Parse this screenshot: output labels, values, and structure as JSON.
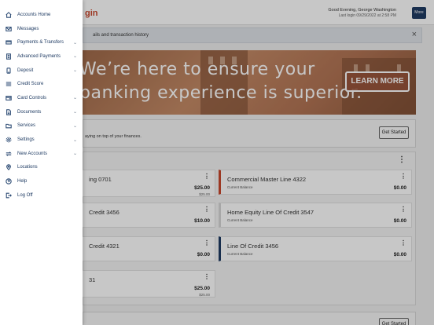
{
  "header": {
    "brand_fragment": "gin",
    "greeting": "Good Evening, George Washington",
    "last_login": "Last login 09/29/2022 at 2:58 PM",
    "more_label": "More"
  },
  "notice": {
    "text": "ails and transaction history"
  },
  "banner": {
    "line1": "We’re here to ensure your",
    "line2": "banking experience is superior.",
    "cta": "LEARN MORE"
  },
  "promo": {
    "text": "aying on top of your finances.",
    "cta": "Get Started"
  },
  "accounts": {
    "left": [
      {
        "name": "ing 0701",
        "amount": "$25.00",
        "sub_amount": "$25.00"
      },
      {
        "name": "Credit 3456",
        "amount": "$10.00"
      },
      {
        "name": "Credit 4321",
        "amount": "$0.00"
      },
      {
        "name": "31",
        "amount": "$25.00",
        "sub_amount": "$25.00"
      }
    ],
    "right": [
      {
        "name": "Commercial Master Line 4322",
        "sub": "Current Balance",
        "amount": "$0.00",
        "accent": "#c8482e"
      },
      {
        "name": "Home Equity Line Of Credit 3547",
        "sub": "Current Balance",
        "amount": "$0.00",
        "accent": "#e0e0e0"
      },
      {
        "name": "Line Of Credit 3456",
        "sub": "Current Balance",
        "amount": "$0.00",
        "accent": "#1f3b63"
      }
    ]
  },
  "bottom": {
    "cta": "Get Started"
  },
  "sidebar": {
    "items": [
      {
        "label": "Accounts Home",
        "icon": "home-icon",
        "chevron": false
      },
      {
        "label": "Messages",
        "icon": "mail-icon",
        "chevron": false
      },
      {
        "label": "Payments & Transfers",
        "icon": "card-icon",
        "chevron": true
      },
      {
        "label": "Advanced Payments",
        "icon": "receipt-icon",
        "chevron": true
      },
      {
        "label": "Deposit",
        "icon": "deposit-icon",
        "chevron": true
      },
      {
        "label": "Credit Score",
        "icon": "list-icon",
        "chevron": false
      },
      {
        "label": "Card Controls",
        "icon": "card-controls-icon",
        "chevron": true
      },
      {
        "label": "Documents",
        "icon": "document-icon",
        "chevron": true
      },
      {
        "label": "Services",
        "icon": "folder-icon",
        "chevron": true
      },
      {
        "label": "Settings",
        "icon": "gear-icon",
        "chevron": true
      },
      {
        "label": "New Accounts",
        "icon": "transfer-icon",
        "chevron": true
      },
      {
        "label": "Locations",
        "icon": "location-icon",
        "chevron": false
      },
      {
        "label": "Help",
        "icon": "help-icon",
        "chevron": false
      },
      {
        "label": "Log Off",
        "icon": "logoff-icon",
        "chevron": false
      }
    ]
  },
  "colors": {
    "primary": "#1f3b63",
    "brand": "#c8482e"
  }
}
